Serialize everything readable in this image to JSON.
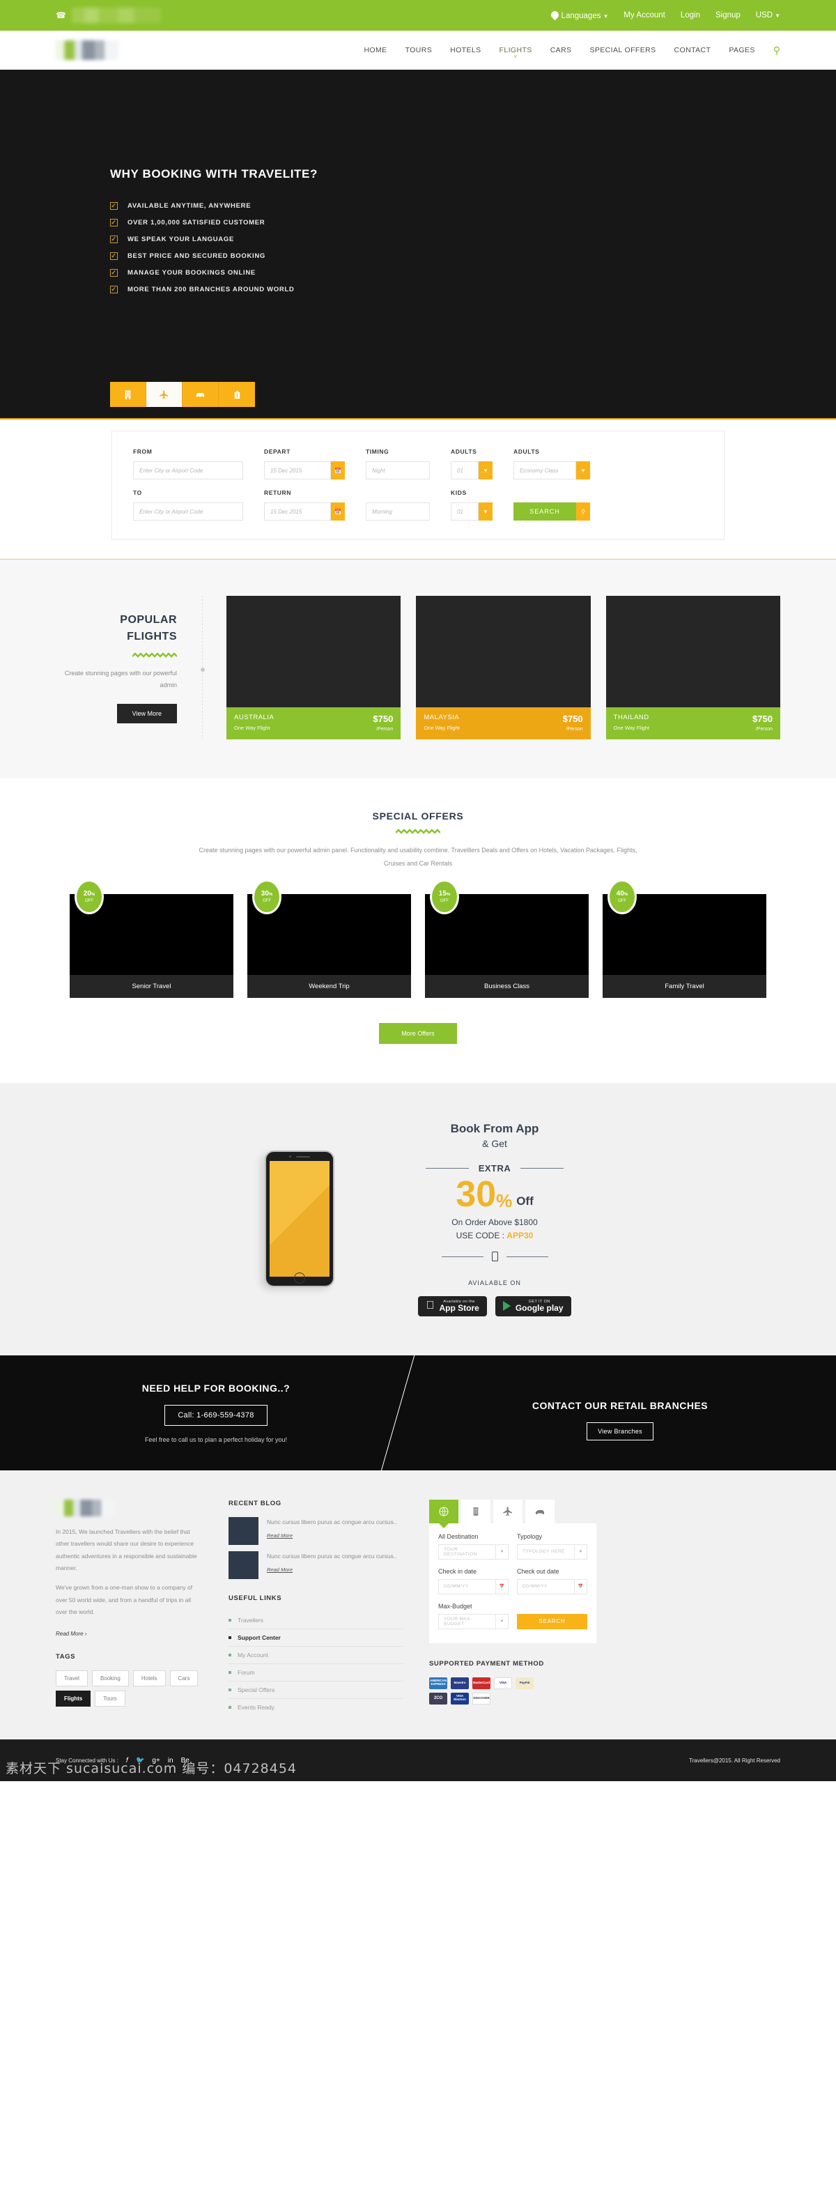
{
  "topbar": {
    "phone_redacted": true,
    "languages": "Languages",
    "my_account": "My Account",
    "login": "Login",
    "signup": "Signup",
    "currency": "USD"
  },
  "nav": {
    "items": [
      {
        "label": "HOME",
        "active": false
      },
      {
        "label": "TOURS",
        "active": false
      },
      {
        "label": "HOTELS",
        "active": false
      },
      {
        "label": "FLIGHTS",
        "active": true
      },
      {
        "label": "CARS",
        "active": false
      },
      {
        "label": "SPECIAL OFFERS",
        "active": false
      },
      {
        "label": "CONTACT",
        "active": false
      },
      {
        "label": "PAGES",
        "active": false
      }
    ],
    "search_icon": "search-icon"
  },
  "hero": {
    "title": "WHY BOOKING WITH TRAVELITE?",
    "bullets": [
      "AVAILABLE ANYTIME, ANYWHERE",
      "OVER 1,00,000 SATISFIED CUSTOMER",
      "WE SPEAK YOUR LANGUAGE",
      "BEST PRICE AND SECURED BOOKING",
      "MANAGE YOUR BOOKINGS ONLINE",
      "MORE THAN 200 BRANCHES AROUND WORLD"
    ],
    "tabs": [
      {
        "icon": "hotel-icon",
        "active": false
      },
      {
        "icon": "plane-icon",
        "active": true
      },
      {
        "icon": "car-icon",
        "active": false
      },
      {
        "icon": "bag-icon",
        "active": false
      }
    ]
  },
  "search_form": {
    "from_label": "FROM",
    "from_placeholder": "Enter City or Airport Code",
    "to_label": "TO",
    "to_placeholder": "Enter City or Airport Code",
    "depart_label": "DEPART",
    "depart_value": "15 Dec 2015",
    "return_label": "RETURN",
    "return_value": "15 Dec 2015",
    "timing_label": "TIMING",
    "timing_value": "Night",
    "timing_value2": "Morning",
    "adults_label": "ADULTS",
    "adults_value": "01",
    "kids_label": "KIDS",
    "kids_value": "01",
    "class_label": "ADULTS",
    "class_value": "Economy Class",
    "search_button": "SEARCH"
  },
  "popular": {
    "title_line1": "POPULAR",
    "title_line2": "FLIGHTS",
    "desc": "Create stunning pages with our powerful admin",
    "button": "View More",
    "cards": [
      {
        "country": "AUSTRALIA",
        "sub": "One Way Flight",
        "price": "$750",
        "per": "/Person",
        "color": "green"
      },
      {
        "country": "MALAYSIA",
        "sub": "One Way Flight",
        "price": "$750",
        "per": "/Person",
        "color": "amber"
      },
      {
        "country": "THAILAND",
        "sub": "One Way Flight",
        "price": "$750",
        "per": "/Person",
        "color": "green"
      }
    ]
  },
  "offers": {
    "title": "SPECIAL OFFERS",
    "desc": "Create stunning pages with our powerful admin panel. Functionality and usability combine. Travelllers Deals and Offers on Hotels, Vacation Packages, Flights, Cruises and Car Rentals",
    "button": "More Offers",
    "cards": [
      {
        "discount": "20",
        "pct": "%",
        "off": "OFF",
        "caption": "Senior Travel"
      },
      {
        "discount": "30",
        "pct": "%",
        "off": "OFF",
        "caption": "Weekend Trip"
      },
      {
        "discount": "15",
        "pct": "%",
        "off": "OFF",
        "caption": "Business Class"
      },
      {
        "discount": "40",
        "pct": "%",
        "off": "OFF",
        "caption": "Family Travel"
      }
    ]
  },
  "app": {
    "title": "Book From App",
    "subtitle": "& Get",
    "extra": "EXTRA",
    "number": "30",
    "percent": "%",
    "off": "Off",
    "order": "On Order Above $1800",
    "use_code_label": "USE CODE : ",
    "code": "APP30",
    "available_on": "AVIALABLE ON",
    "appstore_small": "Available on the",
    "appstore_big": "App Store",
    "play_small": "GET IT ON",
    "play_big": "Google play"
  },
  "help": {
    "left_title": "NEED HELP FOR BOOKING..?",
    "call_button": "Call:  1-669-559-4378",
    "left_note": "Feel free to call us to plan a perfect holiday for you!",
    "right_title": "CONTACT OUR RETAIL BRANCHES",
    "right_button": "View Branches"
  },
  "footer": {
    "about_p1": "In 2015, We launched Travellers with the belief that other travellers would share our desire to experience authentic adventures in a responsible and sustainable manner.",
    "about_p2": "We've grown from a one-man show to a company of over 50 world wide, and from a handful of trips in all over the world.",
    "read_more": "Read More  ›",
    "tags_heading": "TAGS",
    "tags": [
      {
        "label": "Travel",
        "active": false
      },
      {
        "label": "Booking",
        "active": false
      },
      {
        "label": "Hotels",
        "active": false
      },
      {
        "label": "Cars",
        "active": false
      },
      {
        "label": "Flights",
        "active": true
      },
      {
        "label": "Tours",
        "active": false
      }
    ],
    "blog_heading": "RECENT BLOG",
    "blog_items": [
      {
        "text": "Nunc cursus libero purus ac congue arcu cursus..",
        "read_more": "Read More"
      },
      {
        "text": "Nunc cursus libero purus ac congue arcu cursus..",
        "read_more": "Read More"
      }
    ],
    "links_heading": "USEFUL LINKS",
    "links": [
      {
        "label": "Travellers",
        "active": false
      },
      {
        "label": "Support Center",
        "active": true
      },
      {
        "label": "My Account",
        "active": false
      },
      {
        "label": "Forum",
        "active": false
      },
      {
        "label": "Special Offers",
        "active": false
      },
      {
        "label": "Events Ready",
        "active": false
      }
    ],
    "widget": {
      "tabs": [
        {
          "icon": "globe-icon",
          "active": true
        },
        {
          "icon": "hotel-icon",
          "active": false
        },
        {
          "icon": "plane-icon",
          "active": false
        },
        {
          "icon": "car-icon",
          "active": false
        }
      ],
      "destination_label": "All Destination",
      "destination_placeholder": "YOUR DESTINATION",
      "typology_label": "Typology",
      "typology_placeholder": "TYPOLOGY HERE",
      "checkin_label": "Check in date",
      "checkin_placeholder": "DD/MM/YY",
      "checkout_label": "Check out date",
      "checkout_placeholder": "DD/MM/YY",
      "budget_label": "Max-Budget",
      "budget_placeholder": "YOUR MAX-BUDGET",
      "search_button": "SEARCH"
    },
    "payment_heading": "SUPPORTED PAYMENT METHOD",
    "payment_cards": [
      {
        "name": "AMERICAN EXPRESS",
        "key": "amex"
      },
      {
        "name": "Maestro",
        "key": "maestro"
      },
      {
        "name": "MasterCard",
        "key": "mc"
      },
      {
        "name": "VISA",
        "key": "visa"
      },
      {
        "name": "PayPal",
        "key": "paypal"
      },
      {
        "name": "2CO",
        "key": "2co"
      },
      {
        "name": "VISA Electron",
        "key": "velectron"
      },
      {
        "name": "DISCOVER",
        "key": "discover"
      }
    ]
  },
  "bottom": {
    "stay_connected": "Stay Connected with Us :",
    "socials": [
      "facebook-icon",
      "twitter-icon",
      "google-plus-icon",
      "linkedin-icon",
      "behance-icon"
    ],
    "copyright": "Travellers@2015. All Right Reserved",
    "watermark": "素材天下 sucaisucai.com 编号：04728454"
  }
}
